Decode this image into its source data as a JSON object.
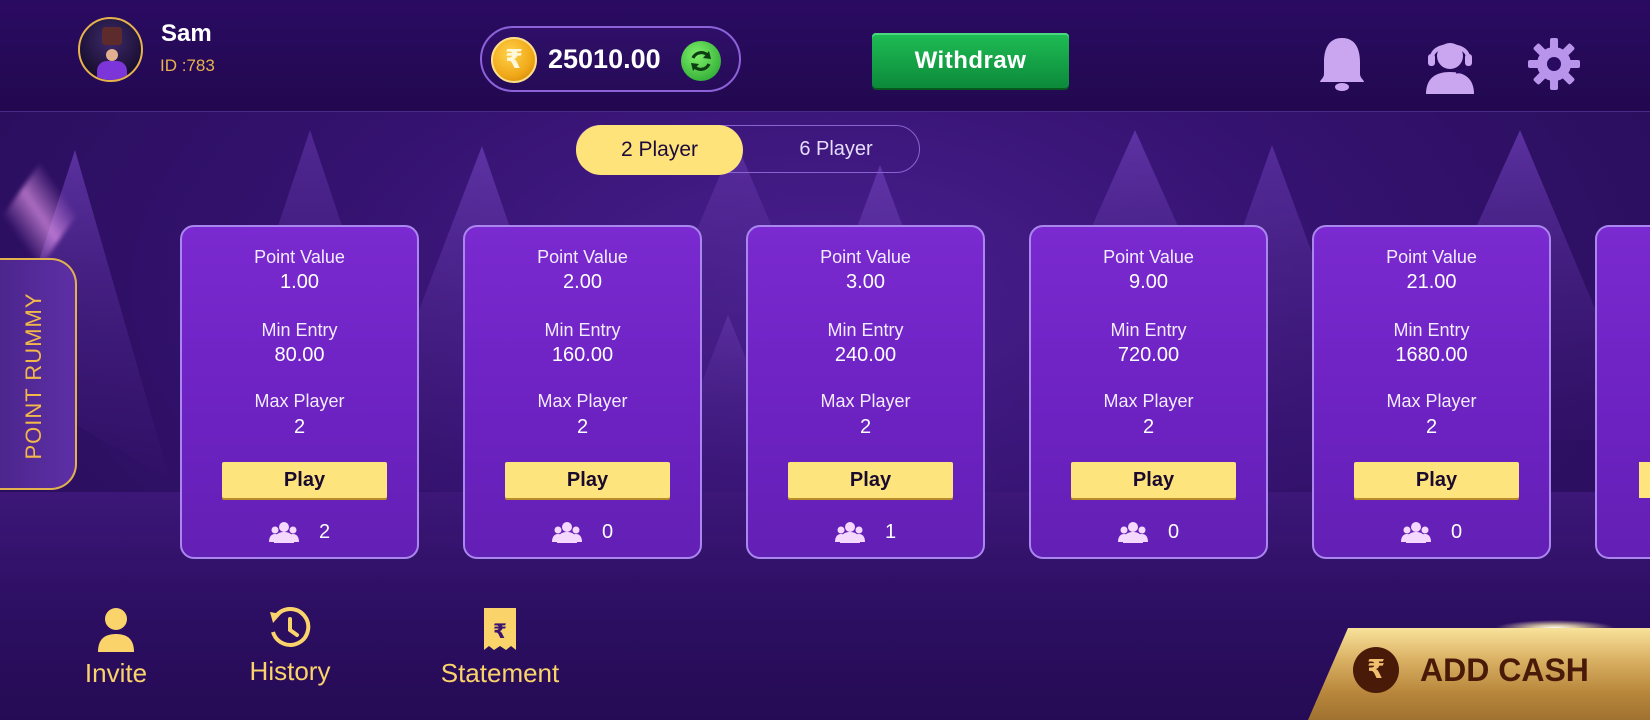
{
  "user": {
    "name": "Sam",
    "id_text": "ID :783"
  },
  "wallet": {
    "currency_icon": "rupee-coin-icon",
    "balance": "25010.00",
    "refresh_icon": "refresh-icon"
  },
  "header": {
    "withdraw_label": "Withdraw",
    "icons": [
      "bell-icon",
      "support-agent-icon",
      "gear-icon"
    ]
  },
  "mode_tabs": {
    "active": "2 Player",
    "inactive": "6 Player"
  },
  "game_mode": "POINT RUMMY",
  "card_labels": {
    "point_value": "Point Value",
    "min_entry": "Min Entry",
    "max_player": "Max Player",
    "play": "Play"
  },
  "tables": [
    {
      "point_value": "1.00",
      "min_entry": "80.00",
      "max_player": "2",
      "players_online": "2"
    },
    {
      "point_value": "2.00",
      "min_entry": "160.00",
      "max_player": "2",
      "players_online": "0"
    },
    {
      "point_value": "3.00",
      "min_entry": "240.00",
      "max_player": "2",
      "players_online": "1"
    },
    {
      "point_value": "9.00",
      "min_entry": "720.00",
      "max_player": "2",
      "players_online": "0"
    },
    {
      "point_value": "21.00",
      "min_entry": "1680.00",
      "max_player": "2",
      "players_online": "0"
    }
  ],
  "bottom_nav": {
    "invite": "Invite",
    "history": "History",
    "statement": "Statement"
  },
  "add_cash": {
    "label": "ADD CASH",
    "icon": "rupee-icon"
  },
  "colors": {
    "accent_gold": "#fde37a",
    "card_purple": "#7a2ad0",
    "withdraw_green": "#16a649",
    "nav_gold": "#fbd36b"
  }
}
